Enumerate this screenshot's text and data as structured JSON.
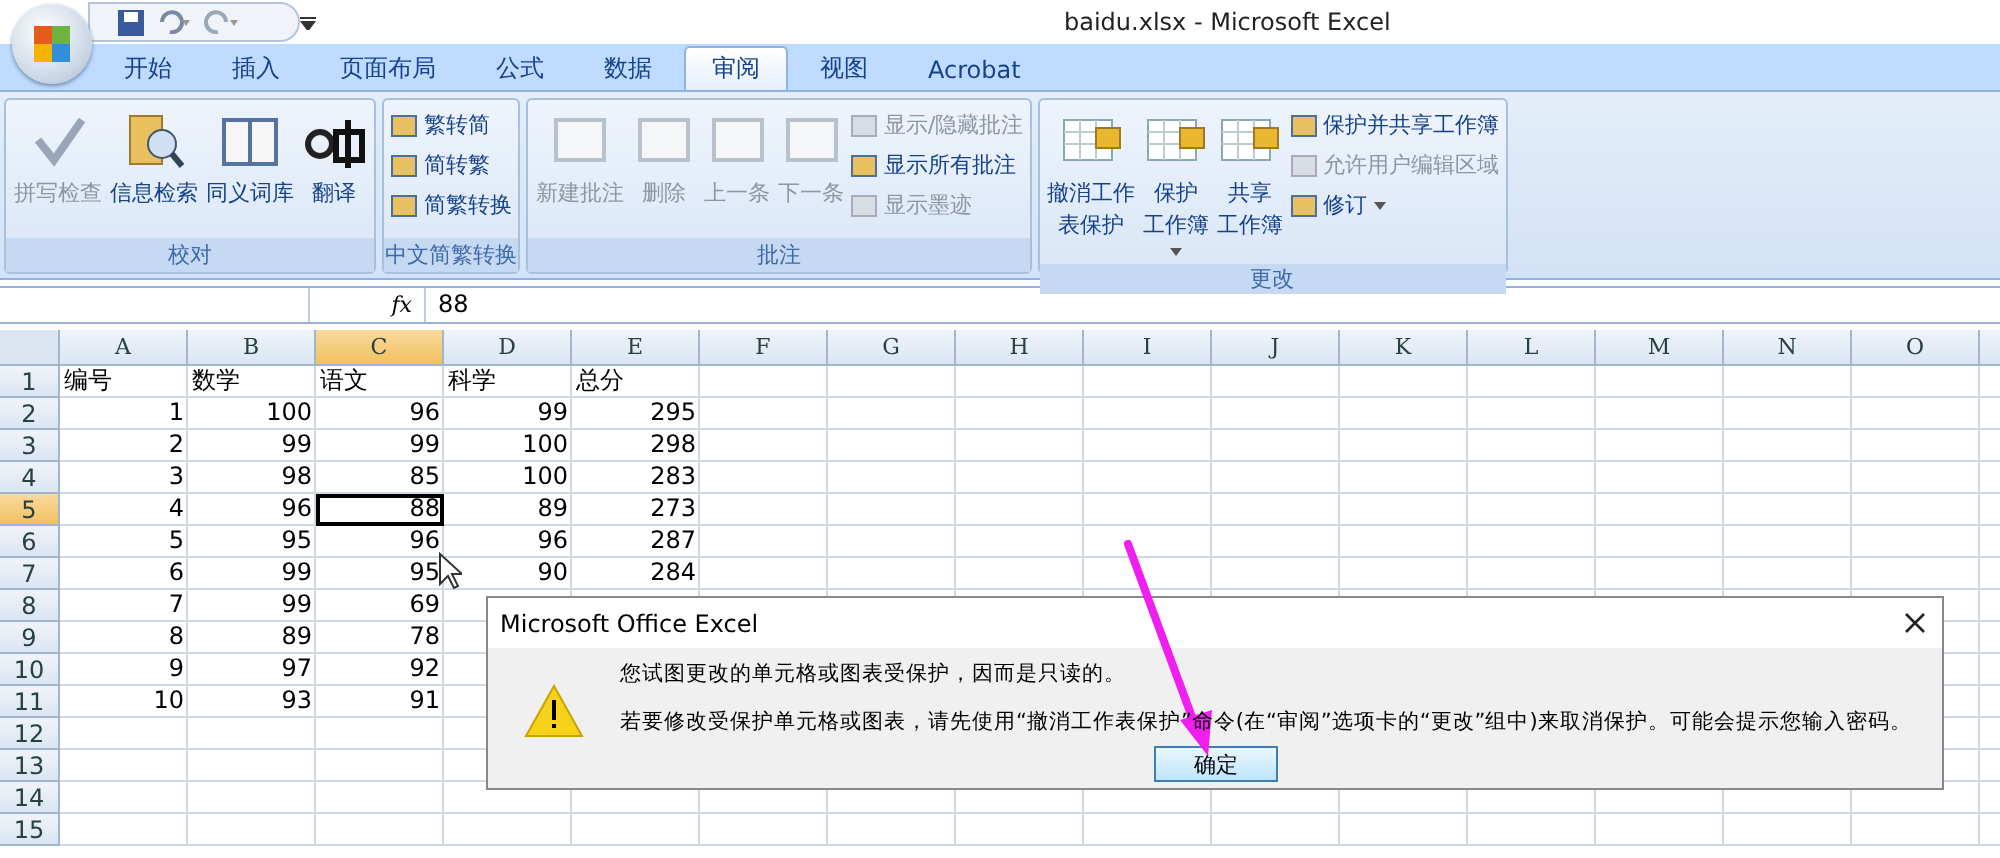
{
  "window": {
    "title": "baidu.xlsx - Microsoft Excel"
  },
  "tabs": [
    {
      "label": "开始",
      "selected": false
    },
    {
      "label": "插入",
      "selected": false
    },
    {
      "label": "页面布局",
      "selected": false
    },
    {
      "label": "公式",
      "selected": false
    },
    {
      "label": "数据",
      "selected": false
    },
    {
      "label": "审阅",
      "selected": true
    },
    {
      "label": "视图",
      "selected": false
    },
    {
      "label": "Acrobat",
      "selected": false
    }
  ],
  "ribbon": [
    {
      "label": "校对",
      "items": [
        {
          "kind": "large",
          "label": "拼写检查",
          "disabled": true
        },
        {
          "kind": "large",
          "label": "信息检索",
          "disabled": false
        },
        {
          "kind": "large",
          "label": "同义词库",
          "disabled": false
        },
        {
          "kind": "large",
          "label": "翻译",
          "disabled": false
        }
      ]
    },
    {
      "label": "中文简繁转换",
      "items": [
        {
          "kind": "small",
          "label": "繁转简",
          "disabled": false
        },
        {
          "kind": "small",
          "label": "简转繁",
          "disabled": false
        },
        {
          "kind": "small",
          "label": "简繁转换",
          "disabled": false
        }
      ]
    },
    {
      "label": "批注",
      "items": [
        {
          "kind": "large",
          "label": "新建批注",
          "disabled": true
        },
        {
          "kind": "large",
          "label": "删除",
          "disabled": true
        },
        {
          "kind": "large",
          "label": "上一条",
          "disabled": true
        },
        {
          "kind": "large",
          "label": "下一条",
          "disabled": true
        },
        {
          "kind": "small",
          "label": "显示/隐藏批注",
          "disabled": true
        },
        {
          "kind": "small",
          "label": "显示所有批注",
          "disabled": false
        },
        {
          "kind": "small",
          "label": "显示墨迹",
          "disabled": true
        }
      ]
    },
    {
      "label": "更改",
      "items": [
        {
          "kind": "large",
          "lines": [
            "撤消工作",
            "表保护"
          ],
          "disabled": false
        },
        {
          "kind": "large",
          "lines": [
            "保护",
            "工作簿"
          ],
          "disabled": false,
          "dropdown": true
        },
        {
          "kind": "large",
          "lines": [
            "共享",
            "工作簿"
          ],
          "disabled": false
        },
        {
          "kind": "small",
          "label": "保护并共享工作簿",
          "disabled": false
        },
        {
          "kind": "small",
          "label": "允许用户编辑区域",
          "disabled": true
        },
        {
          "kind": "small",
          "label": "修订",
          "disabled": false,
          "dropdown": true
        }
      ]
    }
  ],
  "formula_bar": {
    "function_label": "fx",
    "value": "88"
  },
  "sheet": {
    "columns": [
      {
        "label": "A",
        "selected": false
      },
      {
        "label": "B",
        "selected": false
      },
      {
        "label": "C",
        "selected": true
      },
      {
        "label": "D",
        "selected": false
      },
      {
        "label": "E",
        "selected": false
      },
      {
        "label": "F",
        "selected": false
      },
      {
        "label": "G",
        "selected": false
      },
      {
        "label": "H",
        "selected": false
      },
      {
        "label": "I",
        "selected": false
      },
      {
        "label": "J",
        "selected": false
      },
      {
        "label": "K",
        "selected": false
      },
      {
        "label": "L",
        "selected": false
      },
      {
        "label": "M",
        "selected": false
      },
      {
        "label": "N",
        "selected": false
      },
      {
        "label": "O",
        "selected": false
      }
    ],
    "rows": [
      {
        "number": "1",
        "selected": false,
        "cells": [
          "编号",
          "数学",
          "语文",
          "科学",
          "总分"
        ]
      },
      {
        "number": "2",
        "selected": false,
        "cells": [
          "1",
          "100",
          "96",
          "99",
          "295"
        ]
      },
      {
        "number": "3",
        "selected": false,
        "cells": [
          "2",
          "99",
          "99",
          "100",
          "298"
        ]
      },
      {
        "number": "4",
        "selected": false,
        "cells": [
          "3",
          "98",
          "85",
          "100",
          "283"
        ]
      },
      {
        "number": "5",
        "selected": true,
        "cells": [
          "4",
          "96",
          "88",
          "89",
          "273"
        ]
      },
      {
        "number": "6",
        "selected": false,
        "cells": [
          "5",
          "95",
          "96",
          "96",
          "287"
        ]
      },
      {
        "number": "7",
        "selected": false,
        "cells": [
          "6",
          "99",
          "95",
          "90",
          "284"
        ]
      },
      {
        "number": "8",
        "selected": false,
        "cells": [
          "7",
          "99",
          "69"
        ]
      },
      {
        "number": "9",
        "selected": false,
        "cells": [
          "8",
          "89",
          "78"
        ]
      },
      {
        "number": "10",
        "selected": false,
        "cells": [
          "9",
          "97",
          "92"
        ]
      },
      {
        "number": "11",
        "selected": false,
        "cells": [
          "10",
          "93",
          "91"
        ]
      },
      {
        "number": "12",
        "selected": false,
        "cells": []
      },
      {
        "number": "13",
        "selected": false,
        "cells": []
      },
      {
        "number": "14",
        "selected": false,
        "cells": []
      },
      {
        "number": "15",
        "selected": false,
        "cells": []
      }
    ]
  },
  "dialog": {
    "title": "Microsoft Office Excel",
    "lines": [
      "您试图更改的单元格或图表受保护，因而是只读的。",
      "若要修改受保护单元格或图表，请先使用“撤消工作表保护”命令(在“审阅”选项卡的“更改”组中)来取消保护。可能会提示您输入密码。"
    ],
    "button": "确定"
  }
}
